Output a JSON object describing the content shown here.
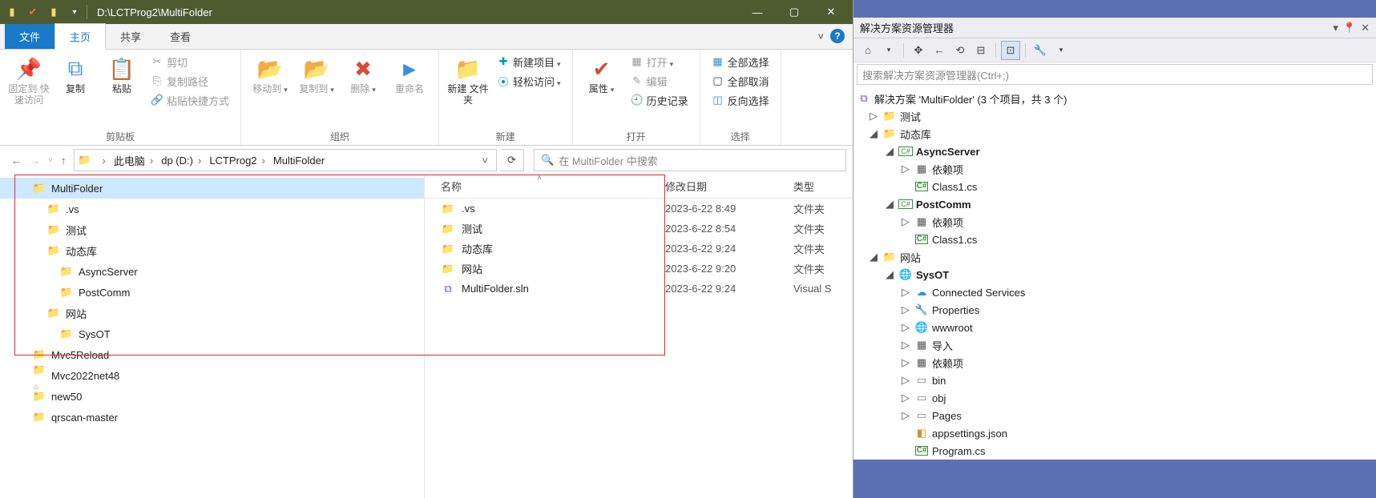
{
  "explorer": {
    "title_path": "D:\\LCTProg2\\MultiFolder",
    "tabs": {
      "file": "文件",
      "home": "主页",
      "share": "共享",
      "view": "查看"
    },
    "ribbon": {
      "clipboard": {
        "label": "剪贴板",
        "pin": "固定到\n快速访问",
        "copy": "复制",
        "paste": "粘贴",
        "cut": "剪切",
        "copy_path": "复制路径",
        "paste_shortcut": "粘贴快捷方式"
      },
      "organize": {
        "label": "组织",
        "move_to": "移动到",
        "copy_to": "复制到",
        "delete": "删除",
        "rename": "重命名"
      },
      "new": {
        "label": "新建",
        "new_folder": "新建\n文件夹",
        "new_item": "新建项目",
        "easy_access": "轻松访问"
      },
      "open": {
        "label": "打开",
        "properties": "属性",
        "open": "打开",
        "edit": "编辑",
        "history": "历史记录"
      },
      "select": {
        "label": "选择",
        "select_all": "全部选择",
        "select_none": "全部取消",
        "invert": "反向选择"
      }
    },
    "breadcrumbs": [
      "此电脑",
      "dp (D:)",
      "LCTProg2",
      "MultiFolder"
    ],
    "search_placeholder": "在 MultiFolder 中搜索",
    "tree": [
      {
        "indent": 40,
        "name": "MultiFolder",
        "sel": true
      },
      {
        "indent": 58,
        "name": ".vs"
      },
      {
        "indent": 58,
        "name": "测试"
      },
      {
        "indent": 58,
        "name": "动态库"
      },
      {
        "indent": 74,
        "name": "AsyncServer"
      },
      {
        "indent": 74,
        "name": "PostComm"
      },
      {
        "indent": 58,
        "name": "网站"
      },
      {
        "indent": 74,
        "name": "SysOT"
      },
      {
        "indent": 40,
        "name": "Mvc5Reload"
      },
      {
        "indent": 40,
        "name": "Mvc2022net48",
        "warn": true
      },
      {
        "indent": 40,
        "name": "new50"
      },
      {
        "indent": 40,
        "name": "qrscan-master"
      }
    ],
    "columns": {
      "name": "名称",
      "date": "修改日期",
      "type": "类型"
    },
    "files": [
      {
        "icon": "folder",
        "name": ".vs",
        "date": "2023-6-22 8:49",
        "type": "文件夹"
      },
      {
        "icon": "folder",
        "name": "测试",
        "date": "2023-6-22 8:54",
        "type": "文件夹"
      },
      {
        "icon": "folder",
        "name": "动态库",
        "date": "2023-6-22 9:24",
        "type": "文件夹"
      },
      {
        "icon": "folder",
        "name": "网站",
        "date": "2023-6-22 9:20",
        "type": "文件夹"
      },
      {
        "icon": "sln",
        "name": "MultiFolder.sln",
        "date": "2023-6-22 9:24",
        "type": "Visual S"
      }
    ]
  },
  "vs": {
    "panel_title": "解决方案资源管理器",
    "search_placeholder": "搜索解决方案资源管理器(Ctrl+;)",
    "root": "解决方案 'MultiFolder' (3 个项目，共 3 个)",
    "nodes": [
      {
        "d": 0,
        "tw": "▸",
        "ic": "fld",
        "nm": "测试"
      },
      {
        "d": 0,
        "tw": "▾",
        "ic": "fld",
        "nm": "动态库"
      },
      {
        "d": 1,
        "tw": "▾",
        "ic": "csproj",
        "nm": "AsyncServer",
        "bold": true
      },
      {
        "d": 2,
        "tw": "▸",
        "ic": "dep",
        "nm": "依赖项"
      },
      {
        "d": 2,
        "tw": "",
        "ic": "cs",
        "nm": "Class1.cs"
      },
      {
        "d": 1,
        "tw": "▾",
        "ic": "csproj",
        "nm": "PostComm",
        "bold": true
      },
      {
        "d": 2,
        "tw": "▸",
        "ic": "dep",
        "nm": "依赖项"
      },
      {
        "d": 2,
        "tw": "",
        "ic": "cs",
        "nm": "Class1.cs"
      },
      {
        "d": 0,
        "tw": "▾",
        "ic": "fld",
        "nm": "网站"
      },
      {
        "d": 1,
        "tw": "▾",
        "ic": "web",
        "nm": "SysOT",
        "bold": true
      },
      {
        "d": 2,
        "tw": "▸",
        "ic": "svc",
        "nm": "Connected Services"
      },
      {
        "d": 2,
        "tw": "▸",
        "ic": "wrench",
        "nm": "Properties"
      },
      {
        "d": 2,
        "tw": "▸",
        "ic": "globe",
        "nm": "wwwroot"
      },
      {
        "d": 2,
        "tw": "▸",
        "ic": "dep",
        "nm": "导入"
      },
      {
        "d": 2,
        "tw": "▸",
        "ic": "dep",
        "nm": "依赖项"
      },
      {
        "d": 2,
        "tw": "▸",
        "ic": "pfld",
        "nm": "bin"
      },
      {
        "d": 2,
        "tw": "▸",
        "ic": "pfld",
        "nm": "obj"
      },
      {
        "d": 2,
        "tw": "▸",
        "ic": "pfld",
        "nm": "Pages"
      },
      {
        "d": 2,
        "tw": "",
        "ic": "json",
        "nm": "appsettings.json"
      },
      {
        "d": 2,
        "tw": "",
        "ic": "cs",
        "nm": "Program.cs"
      }
    ]
  }
}
